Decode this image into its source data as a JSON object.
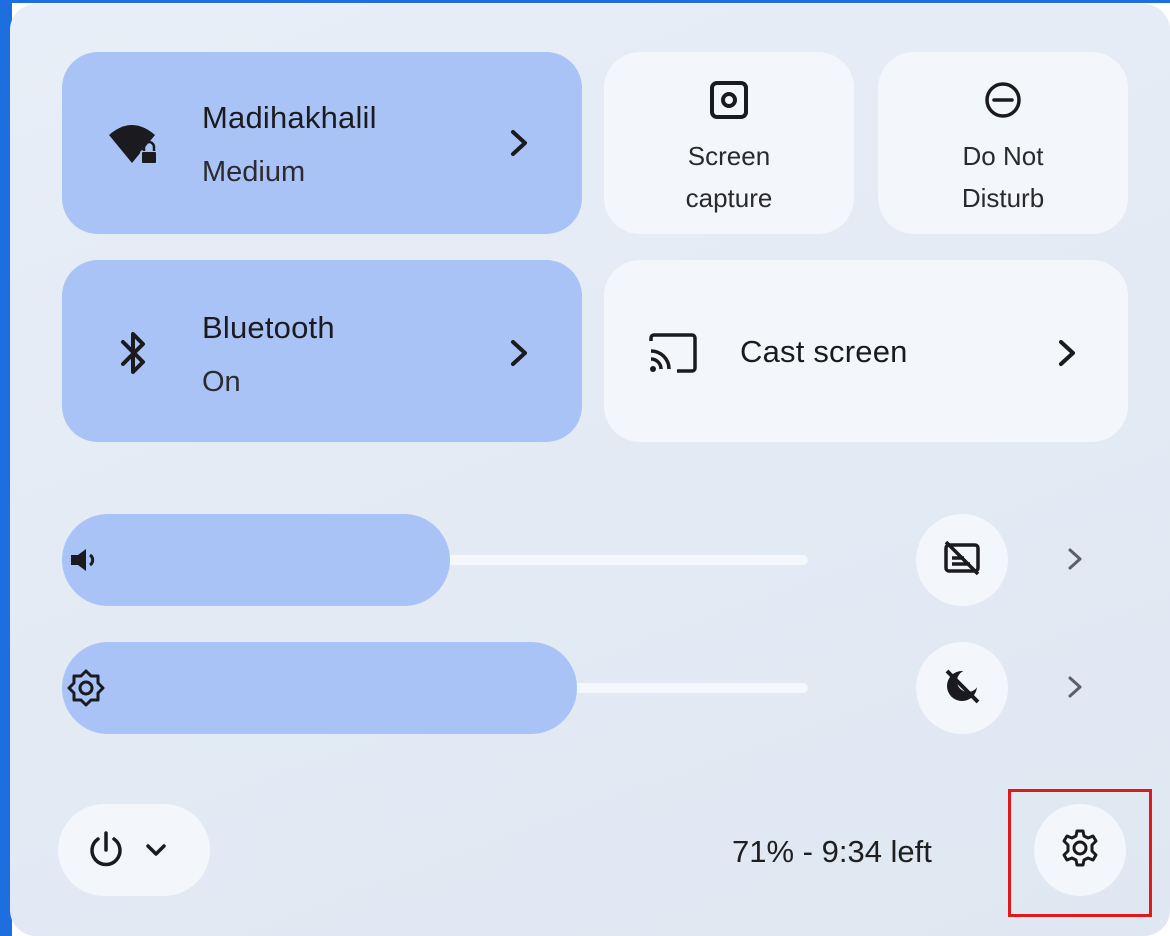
{
  "wifi": {
    "title": "Madihakhalil",
    "status": "Medium",
    "icon": "wifi-lock-icon"
  },
  "bluetooth": {
    "title": "Bluetooth",
    "status": "On",
    "icon": "bluetooth-icon"
  },
  "screen_capture": {
    "line1": "Screen",
    "line2": "capture",
    "icon": "screen-capture-icon"
  },
  "do_not_disturb": {
    "line1": "Do Not",
    "line2": "Disturb",
    "icon": "do-not-disturb-icon"
  },
  "cast": {
    "label": "Cast screen",
    "icon": "cast-icon"
  },
  "volume": {
    "level_percent": 52,
    "icon": "speaker-icon",
    "side_icon": "live-caption-off-icon"
  },
  "brightness": {
    "level_percent": 69,
    "icon": "brightness-icon",
    "side_icon": "night-light-off-icon"
  },
  "battery": {
    "text": "71% - 9:34 left"
  },
  "power": {
    "icon": "power-icon"
  },
  "settings": {
    "icon": "gear-icon"
  },
  "colors": {
    "active_tile": "#a9c3f6",
    "inactive_tile": "#f3f6fb",
    "panel": "#e3eaf4",
    "highlight": "#e0191c"
  }
}
